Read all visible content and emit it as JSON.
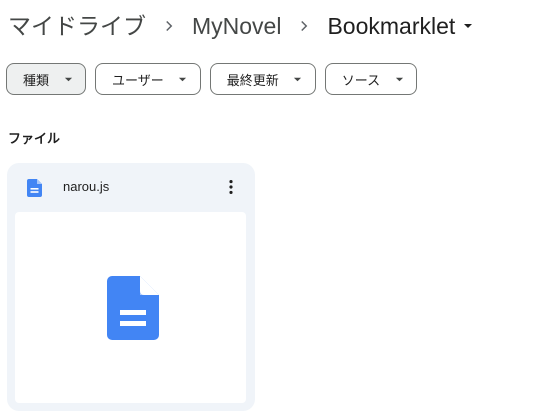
{
  "breadcrumb": {
    "root": "マイドライブ",
    "folder": "MyNovel",
    "current": "Bookmarklet"
  },
  "filters": [
    {
      "label": "種類",
      "active": true
    },
    {
      "label": "ユーザー",
      "active": false
    },
    {
      "label": "最終更新",
      "active": false
    },
    {
      "label": "ソース",
      "active": false
    }
  ],
  "section": {
    "label": "ファイル"
  },
  "files": [
    {
      "name": "narou.js",
      "icon": "document-icon",
      "icon_color": "#4285f4"
    }
  ],
  "colors": {
    "accent": "#4285f4",
    "card_background": "#f0f4f9",
    "active_chip": "#eef0f0"
  }
}
